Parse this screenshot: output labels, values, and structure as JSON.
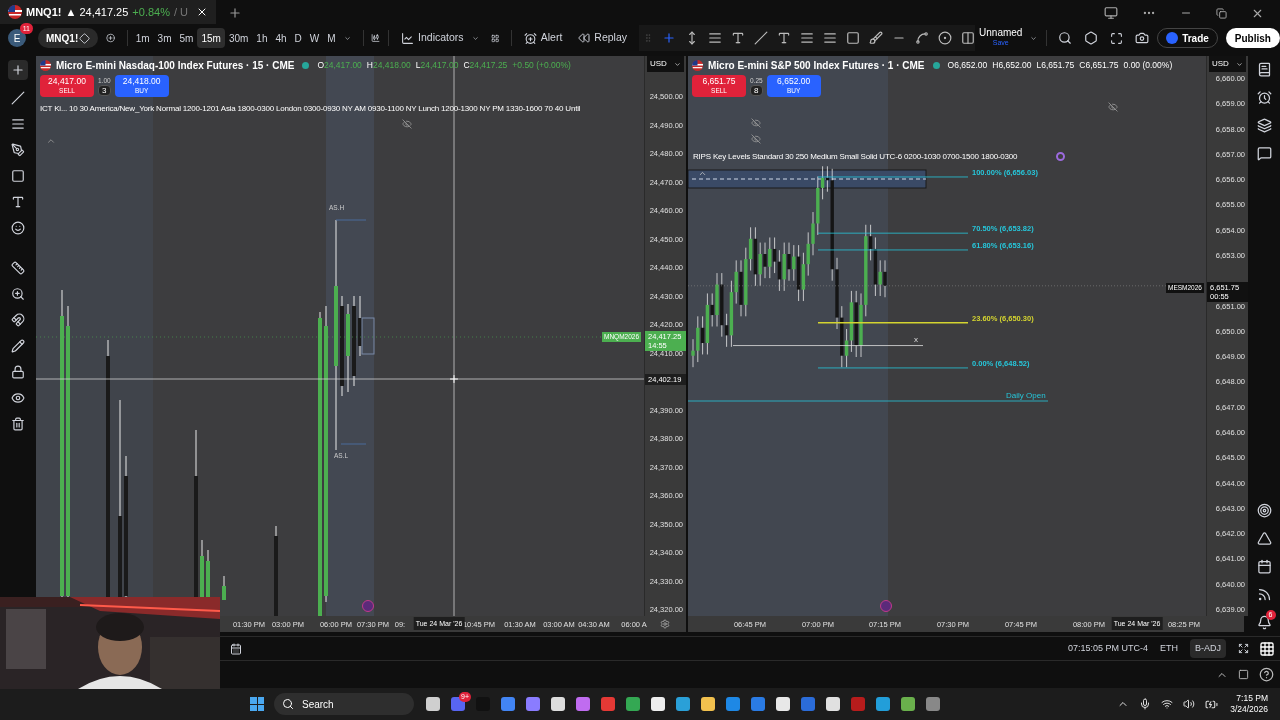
{
  "browser_tab": {
    "symbol": "MNQ1!",
    "price": "▲ 24,417.25",
    "change": "+0.84%",
    "rest": "/ U"
  },
  "toolbar": {
    "avatar": "E",
    "badge": "11",
    "symbol": "MNQ1!",
    "intervals": [
      {
        "label": "1m",
        "selected": false
      },
      {
        "label": "3m",
        "selected": false
      },
      {
        "label": "5m",
        "selected": false
      },
      {
        "label": "15m",
        "selected": true
      },
      {
        "label": "30m",
        "selected": false
      },
      {
        "label": "1h",
        "selected": false
      },
      {
        "label": "4h",
        "selected": false
      },
      {
        "label": "D",
        "selected": false
      },
      {
        "label": "W",
        "selected": false
      },
      {
        "label": "M",
        "selected": false
      }
    ],
    "indicators": "Indicators",
    "alert": "Alert",
    "replay": "Replay",
    "layout_name": "Unnamed",
    "layout_status": "Save",
    "trade": "Trade",
    "publish": "Publish"
  },
  "charts": [
    {
      "title": "Micro E-mini Nasdaq-100 Index Futures · 15 · CME",
      "ohlc": [
        {
          "label": "O",
          "value": "24,417.00"
        },
        {
          "label": "H",
          "value": "24,418.00"
        },
        {
          "label": "L",
          "value": "24,417.00"
        },
        {
          "label": "C",
          "value": "24,417.25"
        }
      ],
      "change": "+0.50 (+0.00%)",
      "sell": {
        "price": "24,417.00",
        "label": "SELL"
      },
      "quantity": "1.00",
      "spread": "3",
      "buy": {
        "price": "24,418.00",
        "label": "BUY"
      },
      "indicator": "ICT Ki...  10 30 America/New_York Normal 1200-1201 Asia 1800-0300 London 0300-0930 NY AM 0930-1100 NY Lunch 1200-1300 NY PM 1330-1600 70 40 Until",
      "currency": "USD",
      "price_labels": [
        "24,500.00",
        "24,490.00",
        "24,480.00",
        "24,470.00",
        "24,460.00",
        "24,450.00",
        "24,440.00",
        "24,430.00",
        "24,420.00",
        "24,410.00",
        "24,390.00",
        "24,380.00",
        "24,370.00",
        "24,360.00",
        "24,350.00",
        "24,340.00",
        "24,330.00",
        "24,320.00"
      ],
      "last_price": {
        "symbol": "MNQM2026",
        "price": "24,417.25",
        "countdown": "14:55"
      },
      "crosshair_price": "24,402.19",
      "annotations": [
        "AS.H",
        "AS.L"
      ],
      "time_labels": [
        "01:30 PM",
        "03:00 PM",
        "06:00 PM",
        "07:30 PM",
        "09:",
        "10:45 PM",
        "01:30 AM",
        "03:00 AM",
        "04:30 AM",
        "06:00 A"
      ],
      "crosshair_time": "Tue 24 Mar '26"
    },
    {
      "title": "Micro E-mini S&P 500 Index Futures · 1 · CME",
      "ohlc": [
        {
          "label": "O",
          "value": "6,652.00"
        },
        {
          "label": "H",
          "value": "6,652.00"
        },
        {
          "label": "L",
          "value": "6,651.75"
        },
        {
          "label": "C",
          "value": "6,651.75"
        }
      ],
      "change": "0.00 (0.00%)",
      "sell": {
        "price": "6,651.75",
        "label": "SELL"
      },
      "quantity": "0.25",
      "spread": "8",
      "buy": {
        "price": "6,652.00",
        "label": "BUY"
      },
      "indicator": "RIPS Key Levels Standard 30 250 Medium Small Solid UTC-6 0200-1030 0700-1500 1800-0300",
      "currency": "USD",
      "price_labels": [
        "6,660.00",
        "6,659.00",
        "6,658.00",
        "6,657.00",
        "6,656.00",
        "6,655.00",
        "6,654.00",
        "6,653.00",
        "6,651.00",
        "6,650.00",
        "6,649.00",
        "6,648.00",
        "6,647.00",
        "6,646.00",
        "6,645.00",
        "6,644.00",
        "6,643.00",
        "6,642.00",
        "6,641.00",
        "6,640.00",
        "6,639.00"
      ],
      "last_price": {
        "symbol": "MESM2026",
        "price": "6,651.75",
        "countdown": "00:55"
      },
      "levels": [
        {
          "label": "100.00% (6,656.03)",
          "color": "#26c6da"
        },
        {
          "label": "70.50% (6,653.82)",
          "color": "#26c6da"
        },
        {
          "label": "61.80% (6,653.16)",
          "color": "#26c6da"
        },
        {
          "label": "23.60% (6,650.30)",
          "color": "#d4d430"
        },
        {
          "label": "0.00% (6,648.52)",
          "color": "#26c6da"
        }
      ],
      "daily_open": "Daily Open",
      "remove_marker": "x",
      "time_labels": [
        "06:45 PM",
        "07:00 PM",
        "07:15 PM",
        "07:30 PM",
        "07:45 PM",
        "08:00 PM",
        "08:25 PM"
      ],
      "crosshair_time": "Tue 24 Mar '26"
    }
  ],
  "bottom_bar": {
    "time": "07:15:05 PM UTC-4",
    "session": "ETH",
    "adjust": "B-ADJ"
  },
  "alerts_badge": "6",
  "taskbar": {
    "search": "Search",
    "badge": "9+",
    "time": "7:15 PM",
    "date": "3/24/2026"
  }
}
